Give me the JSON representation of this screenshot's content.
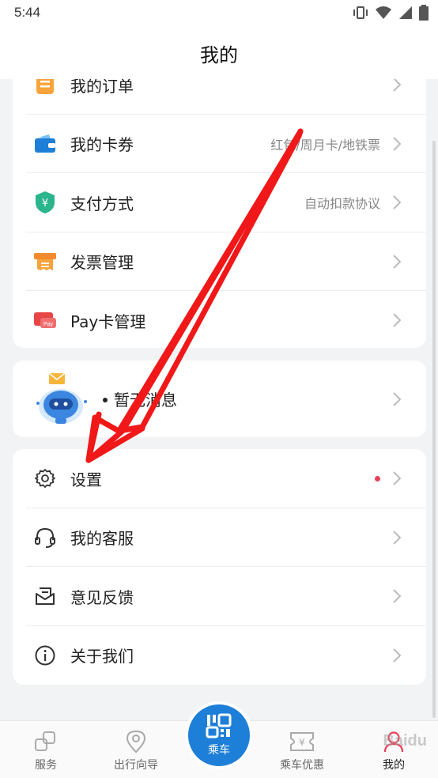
{
  "status": {
    "time": "5:44"
  },
  "header": {
    "title": "我的"
  },
  "card1": [
    {
      "label": "我的订单",
      "hint": ""
    },
    {
      "label": "我的卡券",
      "hint": "红包/周月卡/地铁票"
    },
    {
      "label": "支付方式",
      "hint": "自动扣款协议"
    },
    {
      "label": "发票管理",
      "hint": ""
    },
    {
      "label": "Pay卡管理",
      "hint": ""
    }
  ],
  "message": {
    "text": "暂无消息"
  },
  "card3": [
    {
      "label": "设置"
    },
    {
      "label": "我的客服"
    },
    {
      "label": "意见反馈"
    },
    {
      "label": "关于我们"
    }
  ],
  "tabs": {
    "service": "服务",
    "guide": "出行向导",
    "ride": "乘车",
    "offers": "乘车优惠",
    "mine": "我的"
  },
  "colors": {
    "accent": "#1e7fd8",
    "active_tab": "#e8415a",
    "arrow": "#f01818"
  },
  "watermark": "Baidu"
}
